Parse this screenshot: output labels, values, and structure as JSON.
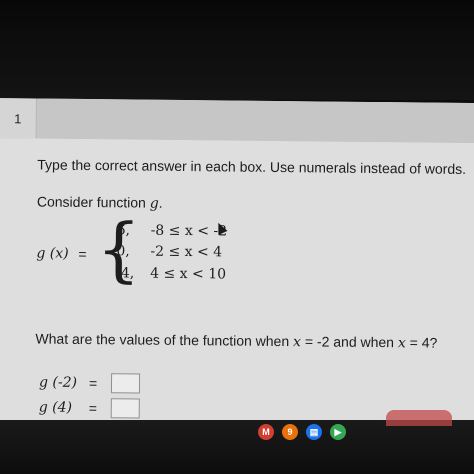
{
  "question": {
    "number": "1",
    "instruction": "Type the correct answer in each box. Use numerals instead of words.",
    "consider_prefix": "Consider function ",
    "function_name": "g",
    "consider_suffix": ".",
    "function_label": "g (x)",
    "equals": "=",
    "cases": [
      {
        "value": "6,",
        "condition": "-8 ≤ x < -2"
      },
      {
        "value": "0,",
        "condition": "-2 ≤ x < 4"
      },
      {
        "value": "-4,",
        "condition": "4 ≤ x < 10"
      }
    ],
    "prompt_part1": "What are the values of the function when ",
    "prompt_var1": "x",
    "prompt_eq1": " = ",
    "prompt_val1": "-2",
    "prompt_mid": " and when ",
    "prompt_var2": "x",
    "prompt_eq2": " = ",
    "prompt_val2": "4",
    "prompt_end": "?",
    "answers": [
      {
        "label": "g (-2)",
        "equals": "=",
        "value": ""
      },
      {
        "label": "g (4)",
        "equals": "=",
        "value": ""
      }
    ]
  },
  "shelf_apps": [
    {
      "icon": "gmail-icon",
      "glyph": "M",
      "color": "#d23f31"
    },
    {
      "icon": "play-music-icon",
      "glyph": "9",
      "color": "#e8710a"
    },
    {
      "icon": "files-icon",
      "glyph": "▤",
      "color": "#1a73e8"
    },
    {
      "icon": "play-store-icon",
      "glyph": "▶",
      "color": "#34a853"
    }
  ]
}
